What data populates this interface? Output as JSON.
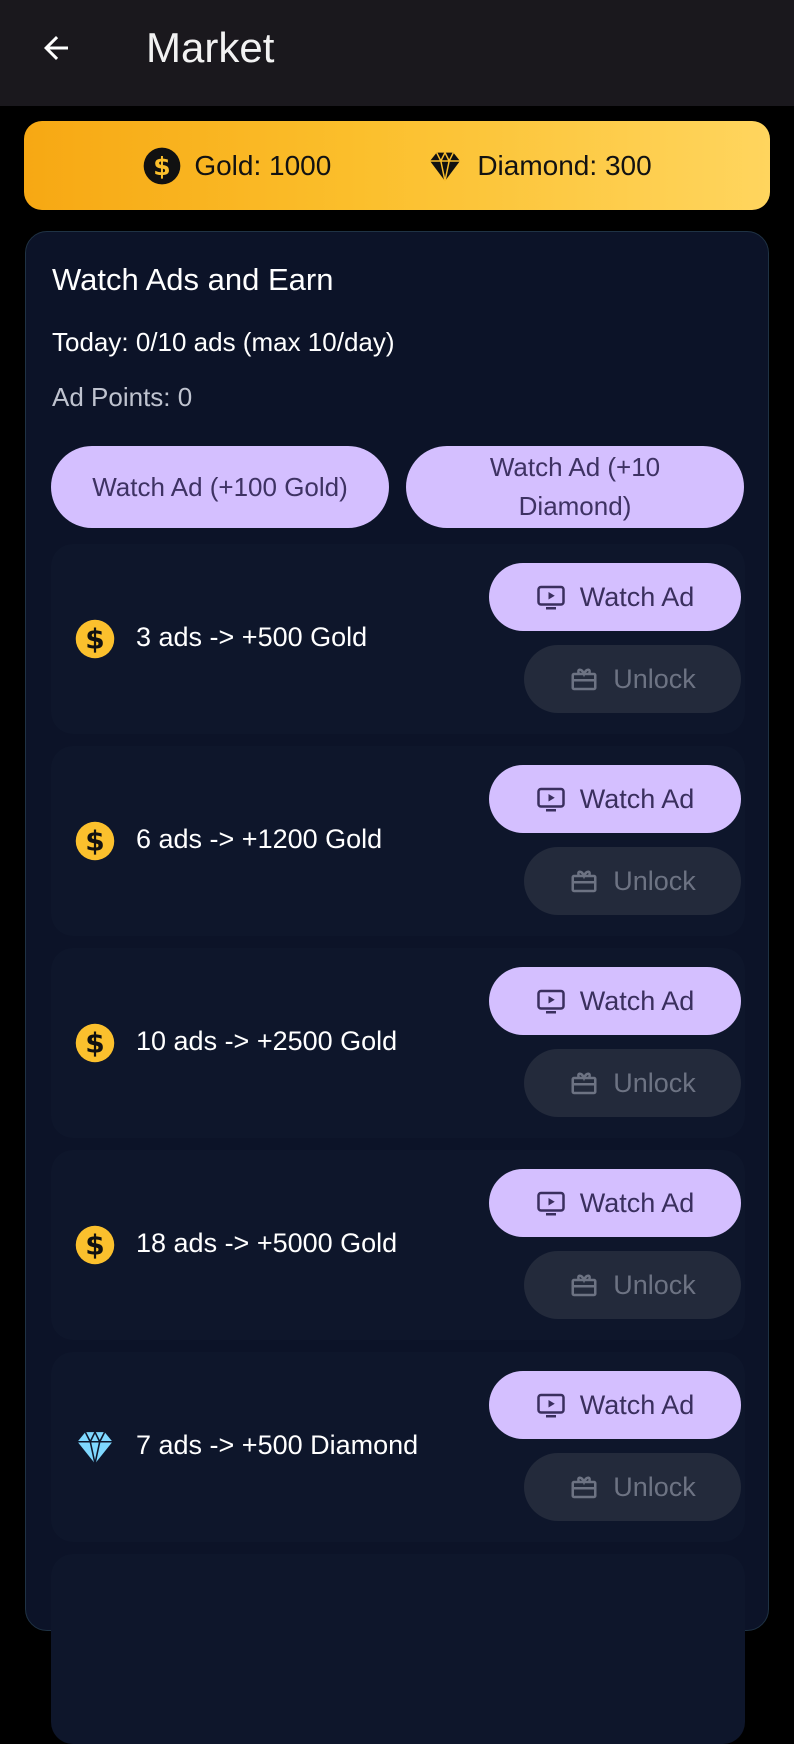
{
  "app_bar": {
    "title": "Market"
  },
  "balance": {
    "gold_label": "Gold: 1000",
    "diamond_label": "Diamond: 300",
    "gradient_start": "#f7a813",
    "gradient_end": "#ffd55e"
  },
  "earn_section": {
    "title": "Watch Ads and Earn",
    "today": "Today: 0/10 ads (max 10/day)",
    "ad_points": "Ad Points: 0",
    "watch_gold_button": "Watch Ad (+100 Gold)",
    "watch_diamond_button": "Watch Ad (+10 Diamond)"
  },
  "offers": [
    {
      "icon": "gold-coin-icon",
      "label": "3 ads -> +500 Gold",
      "watch_label": "Watch Ad",
      "unlock_label": "Unlock"
    },
    {
      "icon": "gold-coin-icon",
      "label": "6 ads -> +1200 Gold",
      "watch_label": "Watch Ad",
      "unlock_label": "Unlock"
    },
    {
      "icon": "gold-coin-icon",
      "label": "10 ads -> +2500 Gold",
      "watch_label": "Watch Ad",
      "unlock_label": "Unlock"
    },
    {
      "icon": "gold-coin-icon",
      "label": "18 ads -> +5000 Gold",
      "watch_label": "Watch Ad",
      "unlock_label": "Unlock"
    },
    {
      "icon": "diamond-icon",
      "label": "7 ads -> +500 Diamond",
      "watch_label": "Watch Ad",
      "unlock_label": "Unlock"
    }
  ],
  "colors": {
    "accent": "#d4bfff",
    "card_background": "#0c1328",
    "gold": "#fbc02d",
    "diamond": "#7fd8ff"
  }
}
